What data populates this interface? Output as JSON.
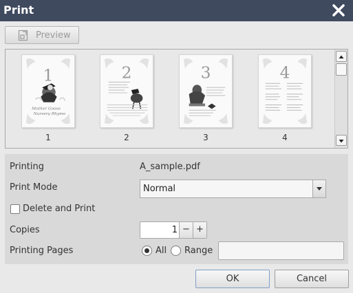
{
  "dialog": {
    "title": "Print"
  },
  "toolbar": {
    "preview_label": "Preview"
  },
  "preview": {
    "pages": [
      {
        "label": "1",
        "number_glyph": "1",
        "caption_line1": "Mother Goose",
        "caption_line2": "Nursery Rhyme"
      },
      {
        "label": "2",
        "number_glyph": "2"
      },
      {
        "label": "3",
        "number_glyph": "3"
      },
      {
        "label": "4",
        "number_glyph": "4"
      }
    ]
  },
  "settings": {
    "printing_label": "Printing",
    "printing_value": "A_sample.pdf",
    "print_mode_label": "Print Mode",
    "print_mode_value": "Normal",
    "delete_and_print_label": "Delete and Print",
    "copies_label": "Copies",
    "copies_value": "1",
    "decrement_symbol": "−",
    "increment_symbol": "+",
    "printing_pages_label": "Printing Pages",
    "all_label": "All",
    "range_label": "Range",
    "range_value": ""
  },
  "actions": {
    "ok_label": "OK",
    "cancel_label": "Cancel"
  },
  "colors": {
    "titlebar": "#3f4a5f",
    "dialog_bg": "#e9e9e9",
    "settings_bg": "#d9d9d9"
  }
}
